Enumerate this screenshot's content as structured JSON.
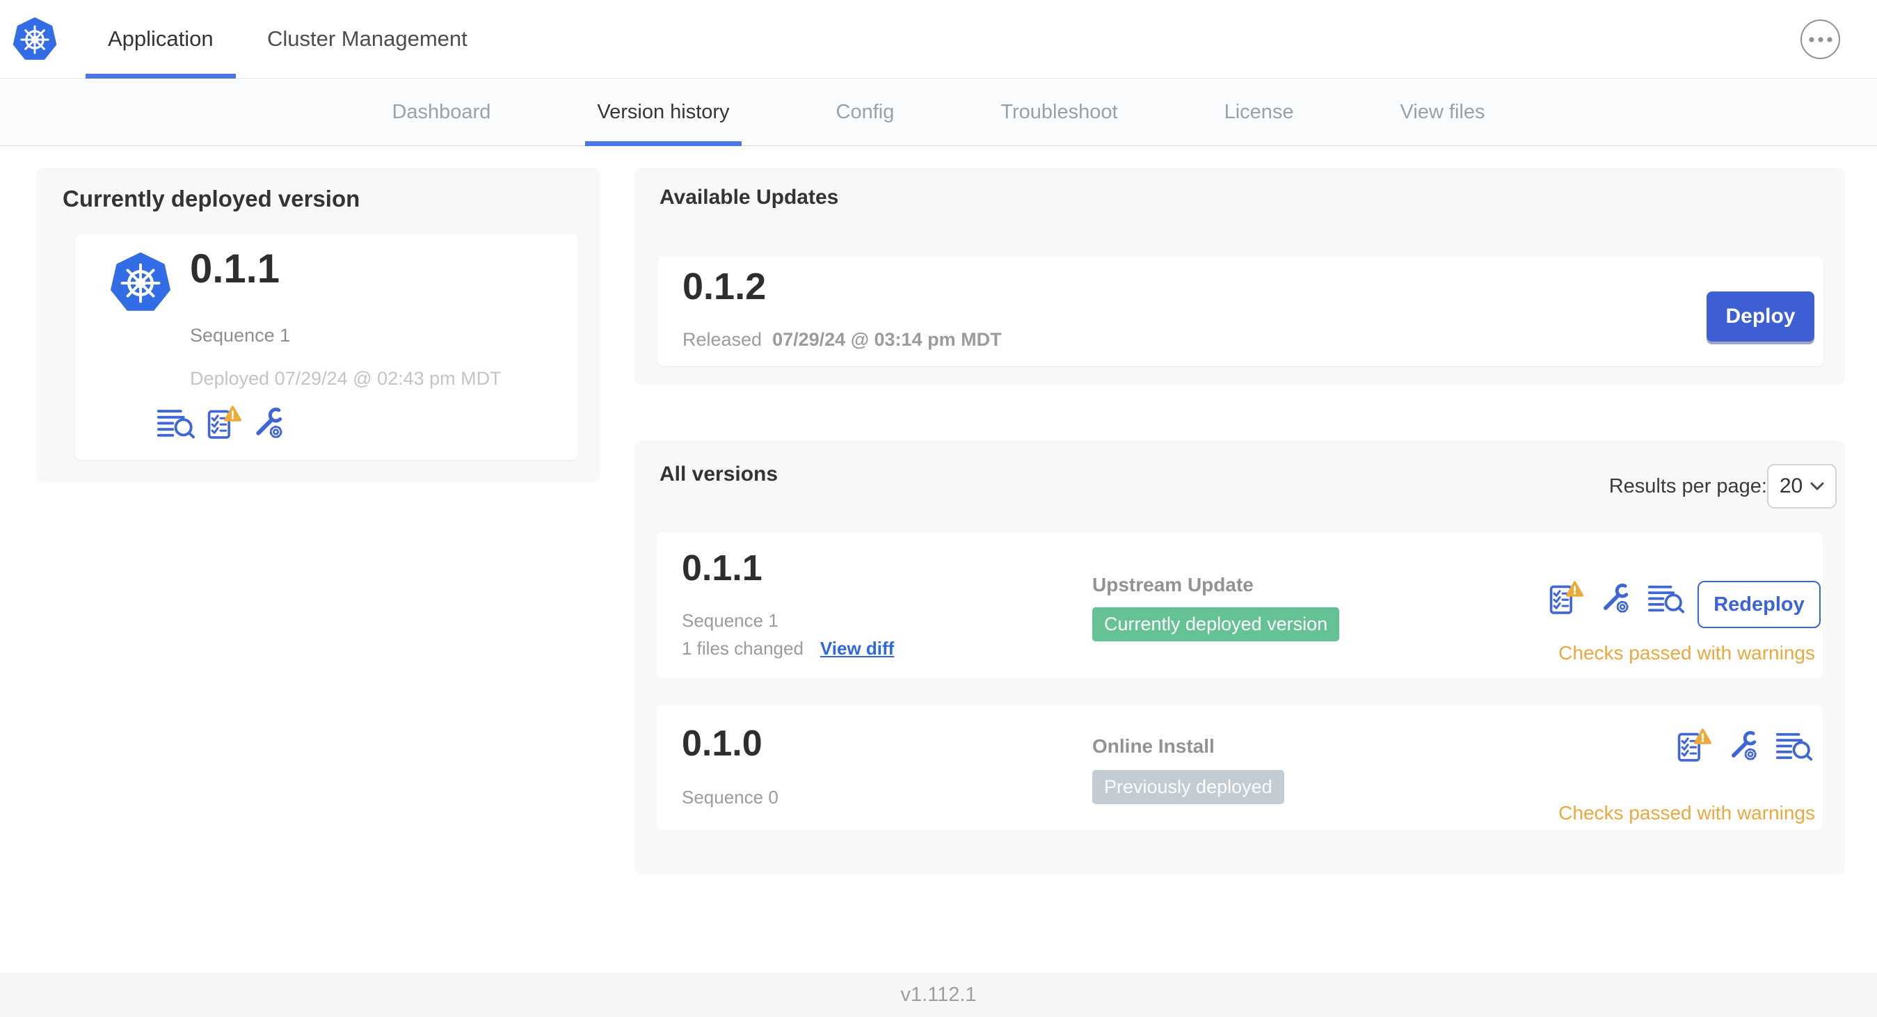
{
  "header": {
    "tabs": [
      {
        "label": "Application"
      },
      {
        "label": "Cluster Management"
      }
    ]
  },
  "subnav": {
    "tabs": [
      {
        "label": "Dashboard"
      },
      {
        "label": "Version history"
      },
      {
        "label": "Config"
      },
      {
        "label": "Troubleshoot"
      },
      {
        "label": "License"
      },
      {
        "label": "View files"
      }
    ]
  },
  "current": {
    "title": "Currently deployed version",
    "version": "0.1.1",
    "sequence": "Sequence 1",
    "deployed": "Deployed 07/29/24 @ 02:43 pm MDT"
  },
  "updates": {
    "title": "Available Updates",
    "version": "0.1.2",
    "released_label": "Released",
    "released_date": "07/29/24 @ 03:14 pm MDT",
    "deploy_label": "Deploy"
  },
  "versions": {
    "title": "All versions",
    "results_label": "Results per page:",
    "results_value": "20",
    "rows": [
      {
        "version": "0.1.1",
        "sequence": "Sequence 1",
        "files_changed": "1 files changed",
        "view_diff_label": "View diff",
        "source": "Upstream Update",
        "badge": "Currently deployed version",
        "checks": "Checks passed with warnings",
        "action_label": "Redeploy"
      },
      {
        "version": "0.1.0",
        "sequence": "Sequence 0",
        "source": "Online Install",
        "badge": "Previously deployed",
        "checks": "Checks passed with warnings"
      }
    ]
  },
  "footer": {
    "version": "v1.112.1"
  },
  "colors": {
    "k8s_blue": "#326de6",
    "accent_blue": "#3e66d9",
    "deploy_blue": "#3e5ed3",
    "link_blue": "#3066e0",
    "badge_green": "#65c294",
    "badge_gray": "#c3ccd2",
    "warning_amber": "#eda73e"
  }
}
